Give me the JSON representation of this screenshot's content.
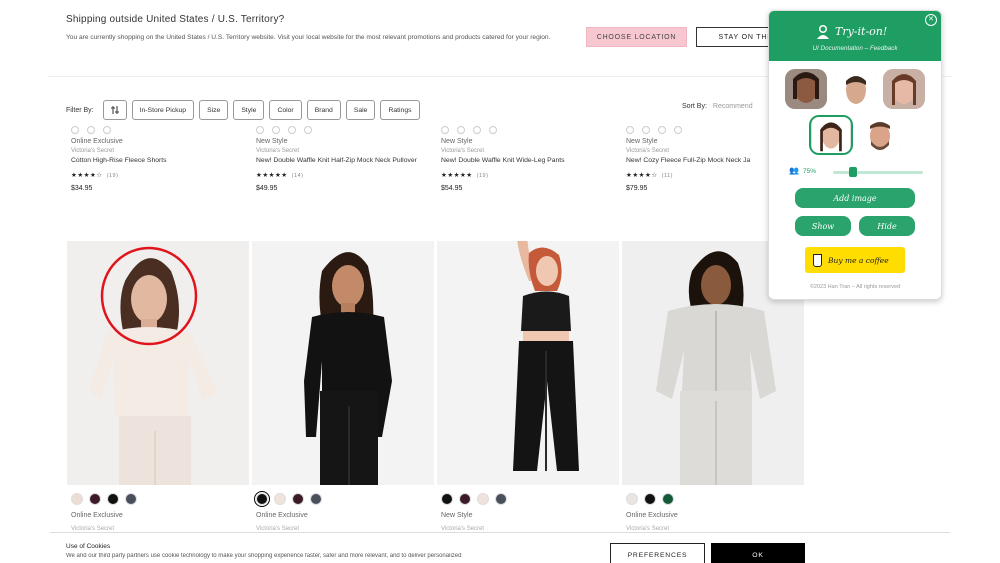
{
  "shipping": {
    "title": "Shipping outside United States / U.S. Territory?",
    "message": "You are currently shopping on the United States / U.S. Territory website. Visit your local website for the most relevant promotions and products catered for your region.",
    "choose_label": "CHOOSE LOCATION",
    "stay_label": "STAY ON THIS"
  },
  "filters": {
    "label": "Filter By:",
    "chips": [
      "In-Store Pickup",
      "Size",
      "Style",
      "Color",
      "Brand",
      "Sale",
      "Ratings"
    ],
    "sort_label": "Sort By:",
    "sort_value": "Recommend"
  },
  "top_products": [
    {
      "badge": "Online Exclusive",
      "brand": "Victoria's Secret",
      "name": "Cotton High-Rise Fleece Shorts",
      "stars": "★★★★☆",
      "reviews": "(19)",
      "price": "$34.95"
    },
    {
      "badge": "New Style",
      "brand": "Victoria's Secret",
      "name": "New! Double Waffle Knit Half-Zip Mock Neck Pullover",
      "stars": "★★★★★",
      "reviews": "(14)",
      "price": "$49.95"
    },
    {
      "badge": "New Style",
      "brand": "Victoria's Secret",
      "name": "New! Double Waffle Knit Wide-Leg Pants",
      "stars": "★★★★★",
      "reviews": "(19)",
      "price": "$54.95"
    },
    {
      "badge": "New Style",
      "brand": "Victoria's Secret",
      "name": "New! Cozy Fleece Full-Zip Mock Neck Ja",
      "stars": "★★★★☆",
      "reviews": "(11)",
      "price": "$79.95"
    }
  ],
  "bottom_products": [
    {
      "badge": "Online Exclusive",
      "brand": "Victoria's Secret",
      "swatches": [
        "#eeddd5",
        "#3b1b27",
        "#111111",
        "#4a4f5c"
      ]
    },
    {
      "badge": "Online Exclusive",
      "brand": "Victoria's Secret",
      "swatches": [
        "#111111",
        "#efe3dc",
        "#3b1b27",
        "#4a4f5c"
      ]
    },
    {
      "badge": "New Style",
      "brand": "Victoria's Secret",
      "swatches": [
        "#111111",
        "#3b1b27",
        "#efe3dc",
        "#4a4f5c"
      ]
    },
    {
      "badge": "Online Exclusive",
      "brand": "Victoria's Secret",
      "swatches": [
        "#e9e6e2",
        "#111111",
        "#145a3a"
      ]
    }
  ],
  "cookie": {
    "title": "Use of Cookies",
    "message": "We and our third party partners use cookie technology to make your shopping experience faster, safer and more relevant, and to deliver personalized",
    "preferences_label": "PREFERENCES",
    "ok_label": "OK"
  },
  "tryon": {
    "title": "Try-it-on!",
    "tagline": "UI Documentation – Feedback",
    "percent": "75%",
    "opacity_fraction": 0.75,
    "add_image": "Add image",
    "show": "Show",
    "hide": "Hide",
    "coffee": "Buy me a coffee",
    "copyright": "©2023 Han Tran – All rights reserved",
    "accent": "#1e9e63"
  }
}
